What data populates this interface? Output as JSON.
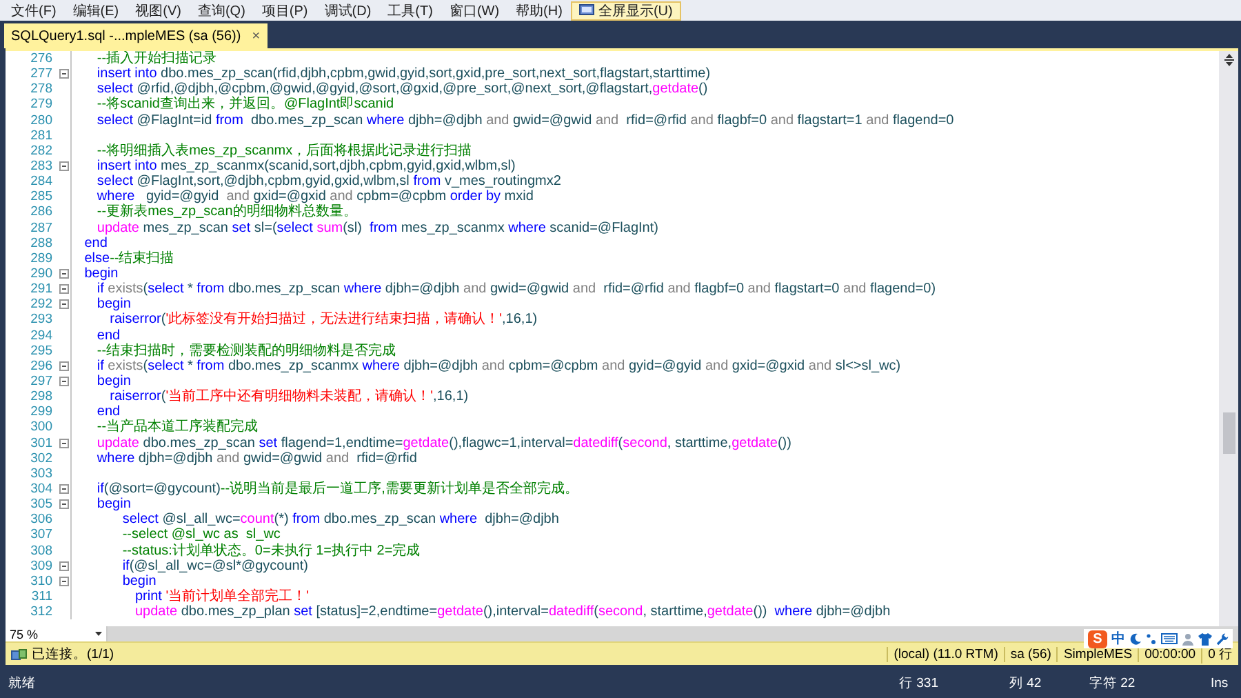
{
  "menu": [
    {
      "label": "文件(F)",
      "selected": false
    },
    {
      "label": "编辑(E)",
      "selected": false
    },
    {
      "label": "视图(V)",
      "selected": false
    },
    {
      "label": "查询(Q)",
      "selected": false
    },
    {
      "label": "项目(P)",
      "selected": false
    },
    {
      "label": "调试(D)",
      "selected": false
    },
    {
      "label": "工具(T)",
      "selected": false
    },
    {
      "label": "窗口(W)",
      "selected": false
    },
    {
      "label": "帮助(H)",
      "selected": false
    },
    {
      "label": "全屏显示(U)",
      "selected": true,
      "kind": "toggle"
    }
  ],
  "tabs": [
    {
      "label": "SQLQuery1.sql -...mpleMES (sa (56))",
      "close": "×",
      "selected": true
    }
  ],
  "editor": {
    "lines": [
      {
        "number": "276",
        "fold": false,
        "tokens": [
          {
            "kind": "cm",
            "text": "\t\t--插入开始扫描记录"
          }
        ]
      },
      {
        "number": "277",
        "fold": true,
        "tokens": [
          {
            "kind": "kw",
            "text": "\t\tinsert into"
          },
          {
            "kind": "id",
            "text": " dbo.mes_zp_scan(rfid,djbh,cpbm,gwid,gyid,sort,gxid,pre_sort,next_sort,flagstart,starttime)"
          }
        ]
      },
      {
        "number": "278",
        "fold": false,
        "tokens": [
          {
            "kind": "kw",
            "text": "\t\tselect"
          },
          {
            "kind": "id",
            "text": " @rfid,@djbh,@cpbm,@gwid,@gyid,@sort,@gxid,@pre_sort,@next_sort,@flagstart,"
          },
          {
            "kind": "fn",
            "text": "getdate"
          },
          {
            "kind": "id",
            "text": "()"
          }
        ]
      },
      {
        "number": "279",
        "fold": false,
        "tokens": [
          {
            "kind": "cm",
            "text": "\t\t--将scanid查询出来，并返回。@FlagInt即scanid"
          }
        ]
      },
      {
        "number": "280",
        "fold": false,
        "tokens": [
          {
            "kind": "kw",
            "text": "\t\tselect"
          },
          {
            "kind": "id",
            "text": " @FlagInt=id "
          },
          {
            "kind": "kw",
            "text": "from"
          },
          {
            "kind": "id",
            "text": "  dbo.mes_zp_scan "
          },
          {
            "kind": "kw",
            "text": "where"
          },
          {
            "kind": "id",
            "text": " djbh=@djbh "
          },
          {
            "kind": "op",
            "text": "and"
          },
          {
            "kind": "id",
            "text": " gwid=@gwid "
          },
          {
            "kind": "op",
            "text": "and"
          },
          {
            "kind": "id",
            "text": "  rfid=@rfid "
          },
          {
            "kind": "op",
            "text": "and"
          },
          {
            "kind": "id",
            "text": " flagbf=0 "
          },
          {
            "kind": "op",
            "text": "and"
          },
          {
            "kind": "id",
            "text": " flagstart=1 "
          },
          {
            "kind": "op",
            "text": "and"
          },
          {
            "kind": "id",
            "text": " flagend=0"
          }
        ]
      },
      {
        "number": "281",
        "fold": false
      },
      {
        "number": "282",
        "fold": false,
        "tokens": [
          {
            "kind": "cm",
            "text": "\t\t--将明细插入表mes_zp_scanmx，后面将根据此记录进行扫描"
          }
        ]
      },
      {
        "number": "283",
        "fold": true,
        "tokens": [
          {
            "kind": "kw",
            "text": "\t\tinsert into"
          },
          {
            "kind": "id",
            "text": " mes_zp_scanmx(scanid,sort,djbh,cpbm,gyid,gxid,wlbm,sl)"
          }
        ]
      },
      {
        "number": "284",
        "fold": false,
        "tokens": [
          {
            "kind": "kw",
            "text": "\t\tselect"
          },
          {
            "kind": "id",
            "text": " @FlagInt,sort,@djbh,cpbm,gyid,gxid,wlbm,sl "
          },
          {
            "kind": "kw",
            "text": "from"
          },
          {
            "kind": "id",
            "text": " v_mes_routingmx2"
          }
        ]
      },
      {
        "number": "285",
        "fold": false,
        "tokens": [
          {
            "kind": "kw",
            "text": "\t\twhere"
          },
          {
            "kind": "id",
            "text": "   gyid=@gyid  "
          },
          {
            "kind": "op",
            "text": "and"
          },
          {
            "kind": "id",
            "text": " gxid=@gxid "
          },
          {
            "kind": "op",
            "text": "and"
          },
          {
            "kind": "id",
            "text": " cpbm=@cpbm "
          },
          {
            "kind": "kw",
            "text": "order by"
          },
          {
            "kind": "id",
            "text": " mxid"
          }
        ]
      },
      {
        "number": "286",
        "fold": false,
        "tokens": [
          {
            "kind": "cm",
            "text": "\t\t--更新表mes_zp_scan的明细物料总数量。"
          }
        ]
      },
      {
        "number": "287",
        "fold": false,
        "tokens": [
          {
            "kind": "fn",
            "text": "\t\tupdate"
          },
          {
            "kind": "id",
            "text": " mes_zp_scan "
          },
          {
            "kind": "kw",
            "text": "set"
          },
          {
            "kind": "id",
            "text": " sl=("
          },
          {
            "kind": "kw",
            "text": "select "
          },
          {
            "kind": "fn",
            "text": "sum"
          },
          {
            "kind": "id",
            "text": "(sl)  "
          },
          {
            "kind": "kw",
            "text": "from"
          },
          {
            "kind": "id",
            "text": " mes_zp_scanmx "
          },
          {
            "kind": "kw",
            "text": "where"
          },
          {
            "kind": "id",
            "text": " scanid=@FlagInt)"
          }
        ]
      },
      {
        "number": "288",
        "fold": false,
        "tokens": [
          {
            "kind": "kw",
            "text": "\tend"
          }
        ]
      },
      {
        "number": "289",
        "fold": false,
        "tokens": [
          {
            "kind": "kw",
            "text": "\telse"
          },
          {
            "kind": "cm",
            "text": "--结束扫描"
          }
        ]
      },
      {
        "number": "290",
        "fold": true,
        "tokens": [
          {
            "kind": "kw",
            "text": "\tbegin"
          }
        ]
      },
      {
        "number": "291",
        "fold": true,
        "tokens": [
          {
            "kind": "kw",
            "text": "\t\tif"
          },
          {
            "kind": "op",
            "text": " exists"
          },
          {
            "kind": "id",
            "text": "("
          },
          {
            "kind": "kw",
            "text": "select"
          },
          {
            "kind": "id",
            "text": " * "
          },
          {
            "kind": "kw",
            "text": "from"
          },
          {
            "kind": "id",
            "text": " dbo.mes_zp_scan "
          },
          {
            "kind": "kw",
            "text": "where"
          },
          {
            "kind": "id",
            "text": " djbh=@djbh "
          },
          {
            "kind": "op",
            "text": "and"
          },
          {
            "kind": "id",
            "text": " gwid=@gwid "
          },
          {
            "kind": "op",
            "text": "and"
          },
          {
            "kind": "id",
            "text": "  rfid=@rfid "
          },
          {
            "kind": "op",
            "text": "and"
          },
          {
            "kind": "id",
            "text": " flagbf=0 "
          },
          {
            "kind": "op",
            "text": "and"
          },
          {
            "kind": "id",
            "text": " flagstart=0 "
          },
          {
            "kind": "op",
            "text": "and"
          },
          {
            "kind": "id",
            "text": " flagend=0)"
          }
        ]
      },
      {
        "number": "292",
        "fold": true,
        "tokens": [
          {
            "kind": "kw",
            "text": "\t\tbegin"
          }
        ]
      },
      {
        "number": "293",
        "fold": false,
        "tokens": [
          {
            "kind": "kw",
            "text": "\t\t\traiserror"
          },
          {
            "kind": "id",
            "text": "("
          },
          {
            "kind": "str",
            "text": "'此标签没有开始扫描过，无法进行结束扫描，请确认！'"
          },
          {
            "kind": "id",
            "text": ",16,1)"
          }
        ]
      },
      {
        "number": "294",
        "fold": false,
        "tokens": [
          {
            "kind": "kw",
            "text": "\t\tend"
          }
        ]
      },
      {
        "number": "295",
        "fold": false,
        "tokens": [
          {
            "kind": "cm",
            "text": "\t\t--结束扫描时，需要检测装配的明细物料是否完成"
          }
        ]
      },
      {
        "number": "296",
        "fold": true,
        "tokens": [
          {
            "kind": "kw",
            "text": "\t\tif"
          },
          {
            "kind": "op",
            "text": " exists"
          },
          {
            "kind": "id",
            "text": "("
          },
          {
            "kind": "kw",
            "text": "select"
          },
          {
            "kind": "id",
            "text": " * "
          },
          {
            "kind": "kw",
            "text": "from"
          },
          {
            "kind": "id",
            "text": " dbo.mes_zp_scanmx "
          },
          {
            "kind": "kw",
            "text": "where"
          },
          {
            "kind": "id",
            "text": " djbh=@djbh "
          },
          {
            "kind": "op",
            "text": "and"
          },
          {
            "kind": "id",
            "text": " cpbm=@cpbm "
          },
          {
            "kind": "op",
            "text": "and"
          },
          {
            "kind": "id",
            "text": " gyid=@gyid "
          },
          {
            "kind": "op",
            "text": "and"
          },
          {
            "kind": "id",
            "text": " gxid=@gxid "
          },
          {
            "kind": "op",
            "text": "and"
          },
          {
            "kind": "id",
            "text": " sl<>sl_wc)"
          }
        ]
      },
      {
        "number": "297",
        "fold": true,
        "tokens": [
          {
            "kind": "kw",
            "text": "\t\tbegin"
          }
        ]
      },
      {
        "number": "298",
        "fold": false,
        "tokens": [
          {
            "kind": "kw",
            "text": "\t\t\traiserror"
          },
          {
            "kind": "id",
            "text": "("
          },
          {
            "kind": "str",
            "text": "'当前工序中还有明细物料未装配，请确认！'"
          },
          {
            "kind": "id",
            "text": ",16,1)"
          }
        ]
      },
      {
        "number": "299",
        "fold": false,
        "tokens": [
          {
            "kind": "kw",
            "text": "\t\tend"
          }
        ]
      },
      {
        "number": "300",
        "fold": false,
        "tokens": [
          {
            "kind": "cm",
            "text": "\t\t--当产品本道工序装配完成"
          }
        ]
      },
      {
        "number": "301",
        "fold": true,
        "tokens": [
          {
            "kind": "fn",
            "text": "\t\tupdate"
          },
          {
            "kind": "id",
            "text": " dbo.mes_zp_scan "
          },
          {
            "kind": "kw",
            "text": "set"
          },
          {
            "kind": "id",
            "text": " flagend=1,endtime="
          },
          {
            "kind": "fn",
            "text": "getdate"
          },
          {
            "kind": "id",
            "text": "(),flagwc=1,interval="
          },
          {
            "kind": "fn",
            "text": "datediff"
          },
          {
            "kind": "id",
            "text": "("
          },
          {
            "kind": "fn",
            "text": "second"
          },
          {
            "kind": "id",
            "text": ", starttime,"
          },
          {
            "kind": "fn",
            "text": "getdate"
          },
          {
            "kind": "id",
            "text": "())"
          }
        ]
      },
      {
        "number": "302",
        "fold": false,
        "tokens": [
          {
            "kind": "kw",
            "text": "\t\twhere"
          },
          {
            "kind": "id",
            "text": " djbh=@djbh "
          },
          {
            "kind": "op",
            "text": "and"
          },
          {
            "kind": "id",
            "text": " gwid=@gwid "
          },
          {
            "kind": "op",
            "text": "and"
          },
          {
            "kind": "id",
            "text": "  rfid=@rfid"
          }
        ]
      },
      {
        "number": "303",
        "fold": false
      },
      {
        "number": "304",
        "fold": true,
        "tokens": [
          {
            "kind": "kw",
            "text": "\t\tif"
          },
          {
            "kind": "id",
            "text": "(@sort=@gycount)"
          },
          {
            "kind": "cm",
            "text": "--说明当前是最后一道工序,需要更新计划单是否全部完成。"
          }
        ]
      },
      {
        "number": "305",
        "fold": true,
        "tokens": [
          {
            "kind": "kw",
            "text": "\t\tbegin"
          }
        ]
      },
      {
        "number": "306",
        "fold": false,
        "tokens": [
          {
            "kind": "kw",
            "text": "\t\t\t\tselect"
          },
          {
            "kind": "id",
            "text": " @sl_all_wc="
          },
          {
            "kind": "fn",
            "text": "count"
          },
          {
            "kind": "id",
            "text": "(*) "
          },
          {
            "kind": "kw",
            "text": "from"
          },
          {
            "kind": "id",
            "text": " dbo.mes_zp_scan "
          },
          {
            "kind": "kw",
            "text": "where"
          },
          {
            "kind": "id",
            "text": "  djbh=@djbh"
          }
        ]
      },
      {
        "number": "307",
        "fold": false,
        "tokens": [
          {
            "kind": "cm",
            "text": "\t\t\t\t--select @sl_wc as  sl_wc"
          }
        ]
      },
      {
        "number": "308",
        "fold": false,
        "tokens": [
          {
            "kind": "cm",
            "text": "\t\t\t\t--status:计划单状态。0=未执行 1=执行中 2=完成"
          }
        ]
      },
      {
        "number": "309",
        "fold": true,
        "tokens": [
          {
            "kind": "kw",
            "text": "\t\t\t\tif"
          },
          {
            "kind": "id",
            "text": "(@sl_all_wc=@sl*@gycount)"
          }
        ]
      },
      {
        "number": "310",
        "fold": true,
        "tokens": [
          {
            "kind": "kw",
            "text": "\t\t\t\tbegin"
          }
        ]
      },
      {
        "number": "311",
        "fold": false,
        "tokens": [
          {
            "kind": "kw",
            "text": "\t\t\t\t\tprint "
          },
          {
            "kind": "str",
            "text": "'当前计划单全部完工！'"
          }
        ]
      },
      {
        "number": "312",
        "fold": false,
        "tokens": [
          {
            "kind": "fn",
            "text": "\t\t\t\t\tupdate"
          },
          {
            "kind": "id",
            "text": " dbo.mes_zp_plan "
          },
          {
            "kind": "kw",
            "text": "set"
          },
          {
            "kind": "id",
            "text": " [status]=2,endtime="
          },
          {
            "kind": "fn",
            "text": "getdate"
          },
          {
            "kind": "id",
            "text": "(),interval="
          },
          {
            "kind": "fn",
            "text": "datediff"
          },
          {
            "kind": "id",
            "text": "("
          },
          {
            "kind": "fn",
            "text": "second"
          },
          {
            "kind": "id",
            "text": ", starttime,"
          },
          {
            "kind": "fn",
            "text": "getdate"
          },
          {
            "kind": "id",
            "text": "())  "
          },
          {
            "kind": "kw",
            "text": "where"
          },
          {
            "kind": "id",
            "text": " djbh=@djbh"
          }
        ]
      }
    ]
  },
  "zoom": "75 %",
  "ime": {
    "logo": "S",
    "mode": "中"
  },
  "connection_bar": {
    "message": "已连接。(1/1)",
    "server": "(local) (11.0 RTM)",
    "user": "sa (56)",
    "database": "SimpleMES",
    "elapsed": "00:00:00",
    "rows": "0 行"
  },
  "status_bar": {
    "state": "就绪",
    "line": "行 331",
    "column": "列 42",
    "char": "字符 22",
    "mode": "Ins"
  }
}
